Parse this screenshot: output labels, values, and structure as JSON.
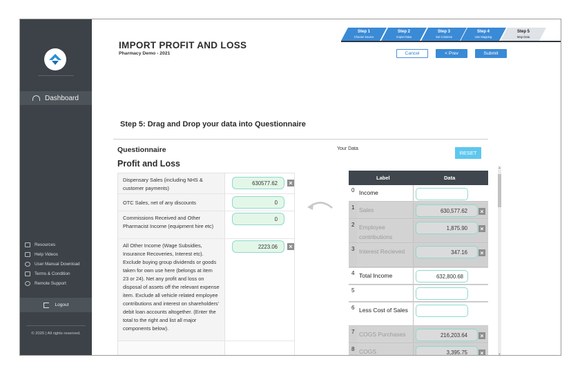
{
  "sidebar": {
    "dashboard_label": "Dashboard",
    "links": [
      "Resources",
      "Help Videos",
      "User Manual Download",
      "Terms & Condition",
      "Remote Support"
    ],
    "logout_label": "Logout",
    "copyright": "© 2020 | All rights reserved."
  },
  "header": {
    "title": "IMPORT PROFIT AND LOSS",
    "subtitle": "Pharmacy Demo - 2021",
    "steps": [
      {
        "num": "Step 1",
        "label": "Choose Source"
      },
      {
        "num": "Step 2",
        "label": "Import Data"
      },
      {
        "num": "Step 3",
        "label": "Set Columns"
      },
      {
        "num": "Step 4",
        "label": "Use Mapping"
      },
      {
        "num": "Step 5",
        "label": "Map Data"
      }
    ],
    "cancel_label": "Cancel",
    "prev_label": "< Prev",
    "submit_label": "Submit"
  },
  "main": {
    "step_heading": "Step 5: Drag and Drop your data into Questionnaire",
    "questionnaire_label": "Questionnaire",
    "section_title": "Profit and Loss",
    "rows": [
      {
        "label": "Dispensary Sales (including NHS & customer payments)",
        "value": "630577.62",
        "removable": true
      },
      {
        "label": "OTC Sales, net of any discounts",
        "value": "0",
        "removable": false
      },
      {
        "label": "Commissions Received and Other Pharmacist Income (equipment hire etc)",
        "value": "0",
        "removable": false
      },
      {
        "label": "All Other Income (Wage Subsidies, Insurance Recoveries, Interest etc). Exclude buying group dividends or goods taken for own use here (belongs at item 23 or 24). Net any profit and loss on disposal of assets off the relevant expense item. Exclude all vehicle related employee contributions and interest on shareholders' debit loan accounts altogether. (Enter the total to the right and list all major components below).",
        "value": "2223.06",
        "removable": true
      }
    ]
  },
  "your_data": {
    "label": "Your Data",
    "reset_label": "RESET",
    "col_label": "Label",
    "col_data": "Data",
    "rows": [
      {
        "idx": "0",
        "label": "Income",
        "value": "",
        "state": "white",
        "removable": false
      },
      {
        "idx": "1",
        "label": "Sales",
        "value": "630,577.62",
        "state": "grey",
        "removable": true
      },
      {
        "idx": "2",
        "label": "Employee contributions",
        "value": "1,875.90",
        "state": "grey",
        "removable": true
      },
      {
        "idx": "3",
        "label": "Interest Recieved",
        "value": "347.16",
        "state": "grey",
        "removable": true
      },
      {
        "idx": "4",
        "label": "Total Income",
        "value": "632,800.68",
        "state": "white",
        "removable": false
      },
      {
        "idx": "5",
        "label": "",
        "value": "",
        "state": "white",
        "removable": false
      },
      {
        "idx": "6",
        "label": "Less Cost of Sales",
        "value": "",
        "state": "white",
        "removable": false
      },
      {
        "idx": "7",
        "label": "COGS Purchases",
        "value": "216,203.64",
        "state": "grey",
        "removable": true
      },
      {
        "idx": "8",
        "label": "COGS",
        "value": "3,395.75",
        "state": "grey",
        "removable": true
      }
    ]
  },
  "colors": {
    "sidebar": "#3c4247",
    "accent": "#3a8ad6",
    "reset": "#5ec7ee",
    "input_border": "#8fd8cf"
  }
}
